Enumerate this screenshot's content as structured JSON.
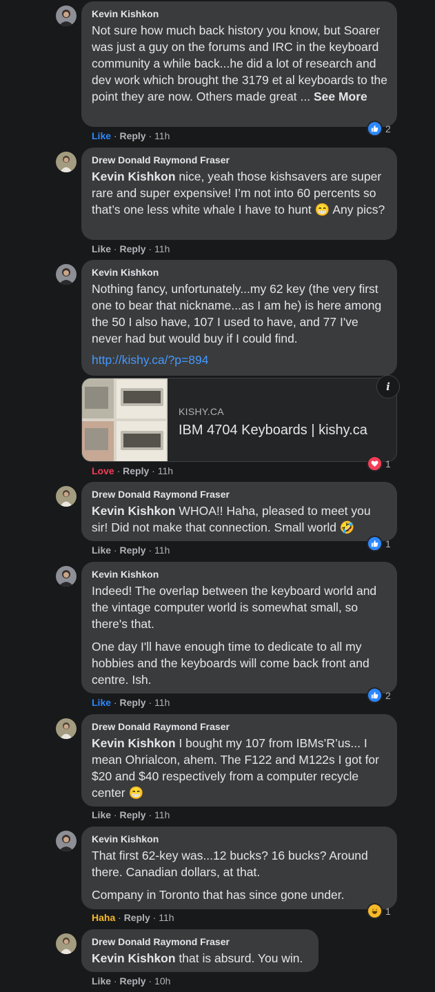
{
  "comments": [
    {
      "author": "Kevin Kishkon",
      "mention": "",
      "text": "Not sure how much back history you know, but Soarer was just a guy on the forums and IRC in the keyboard community a while back...he did a lot of research and dev work which brought the 3179 et al keyboards to the point they are now. Others made great ... ",
      "see_more": "See More",
      "action": "Like",
      "reply": "Reply",
      "time": "11h",
      "reaction": "like",
      "reaction_count": "2"
    },
    {
      "author": "Drew Donald Raymond Fraser",
      "mention": "Kevin Kishkon",
      "text": " nice, yeah those kishsavers are super rare and super expensive! I’m not into 60 percents so that’s one less white whale I have to hunt 😁 Any pics?",
      "action": "Like",
      "reply": "Reply",
      "time": "11h"
    },
    {
      "author": "Kevin Kishkon",
      "text": "Nothing fancy, unfortunately...my 62 key (the very first one to bear that nickname...as I am he) is here among the 50 I also have, 107 I used to have, and 77 I've never had but would buy if I could find.",
      "link": "http://kishy.ca/?p=894",
      "preview": {
        "domain": "KISHY.CA",
        "title": "IBM 4704 Keyboards | kishy.ca",
        "info_icon": "info-icon"
      },
      "action": "Love",
      "reply": "Reply",
      "time": "11h",
      "reaction": "love",
      "reaction_count": "1"
    },
    {
      "author": "Drew Donald Raymond Fraser",
      "mention": "Kevin Kishkon",
      "text": " WHOA!! Haha, pleased to meet you sir! Did not make that connection. Small world 🤣",
      "action": "Like",
      "reply": "Reply",
      "time": "11h",
      "reaction": "like",
      "reaction_count": "1"
    },
    {
      "author": "Kevin Kishkon",
      "text": "Indeed! The overlap between the keyboard world and the vintage computer world is somewhat small, so there's that.",
      "text2": "One day I'll have enough time to dedicate to all my hobbies and the keyboards will come back front and centre. Ish.",
      "action": "Like",
      "reply": "Reply",
      "time": "11h",
      "reaction": "like",
      "reaction_count": "2"
    },
    {
      "author": "Drew Donald Raymond Fraser",
      "mention": "Kevin Kishkon",
      "text": " I bought my 107 from IBMs’R’us... I mean Ohrialcon, ahem. The F122 and M122s I got for $20 and $40 respectively from a computer recycle center 😁",
      "action": "Like",
      "reply": "Reply",
      "time": "11h"
    },
    {
      "author": "Kevin Kishkon",
      "text": "That first 62-key was...12 bucks? 16 bucks? Around there. Canadian dollars, at that.",
      "text2": "Company in Toronto that has since gone under.",
      "action": "Haha",
      "reply": "Reply",
      "time": "11h",
      "reaction": "haha",
      "reaction_count": "1"
    },
    {
      "author": "Drew Donald Raymond Fraser",
      "mention": "Kevin Kishkon",
      "text": " that is absurd. You win.",
      "action": "Like",
      "reply": "Reply",
      "time": "10h"
    }
  ],
  "colors": {
    "background": "#18191a",
    "bubble": "#3a3b3c",
    "like_blue": "#2d88ff",
    "love_red": "#f33e58",
    "haha_yellow": "#f7b928",
    "link": "#4599ff"
  }
}
